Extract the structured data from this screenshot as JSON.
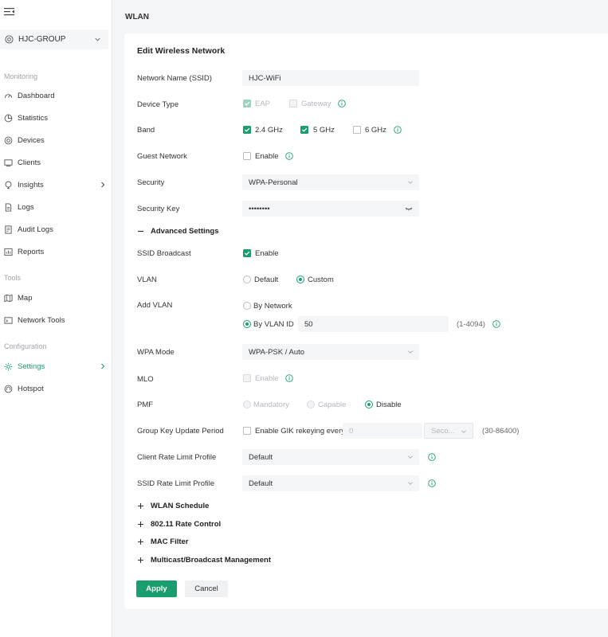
{
  "sidebar": {
    "site": "HJC-GROUP",
    "sections": [
      {
        "label": "Monitoring",
        "items": [
          {
            "label": "Dashboard",
            "icon": "dashboard-icon"
          },
          {
            "label": "Statistics",
            "icon": "pie-chart-icon"
          },
          {
            "label": "Devices",
            "icon": "devices-icon"
          },
          {
            "label": "Clients",
            "icon": "clients-icon"
          },
          {
            "label": "Insights",
            "icon": "bulb-icon"
          },
          {
            "label": "Logs",
            "icon": "logs-icon"
          },
          {
            "label": "Audit Logs",
            "icon": "audit-icon"
          },
          {
            "label": "Reports",
            "icon": "reports-icon"
          }
        ]
      },
      {
        "label": "Tools",
        "items": [
          {
            "label": "Map",
            "icon": "map-icon"
          },
          {
            "label": "Network Tools",
            "icon": "tools-icon"
          }
        ]
      },
      {
        "label": "Configuration",
        "items": [
          {
            "label": "Settings",
            "icon": "gear-icon"
          },
          {
            "label": "Hotspot",
            "icon": "hotspot-icon"
          }
        ]
      }
    ]
  },
  "page": {
    "title": "WLAN"
  },
  "form": {
    "title": "Edit Wireless Network",
    "ssid": {
      "label": "Network Name (SSID)",
      "value": "HJC-WiFi"
    },
    "device_type": {
      "label": "Device Type",
      "eap": "EAP",
      "gateway": "Gateway"
    },
    "band": {
      "label": "Band",
      "b24": "2.4 GHz",
      "b5": "5 GHz",
      "b6": "6 GHz"
    },
    "guest": {
      "label": "Guest Network",
      "option": "Enable"
    },
    "security": {
      "label": "Security",
      "value": "WPA-Personal"
    },
    "security_key": {
      "label": "Security Key",
      "value": "••••••••"
    },
    "advanced": {
      "label": "Advanced Settings"
    },
    "ssid_broadcast": {
      "label": "SSID Broadcast",
      "option": "Enable"
    },
    "vlan": {
      "label": "VLAN",
      "default": "Default",
      "custom": "Custom"
    },
    "add_vlan": {
      "label": "Add VLAN",
      "by_network": "By Network",
      "by_vlan_id": "By VLAN ID",
      "value": "50",
      "range": "(1-4094)"
    },
    "wpa_mode": {
      "label": "WPA Mode",
      "value": "WPA-PSK / Auto"
    },
    "mlo": {
      "label": "MLO",
      "option": "Enable"
    },
    "pmf": {
      "label": "PMF",
      "mandatory": "Mandatory",
      "capable": "Capable",
      "disable": "Disable"
    },
    "gik": {
      "label": "Group Key Update Period",
      "option": "Enable GIK rekeying every",
      "value": "0",
      "unit": "Seco...",
      "range": "(30-86400)"
    },
    "client_rate": {
      "label": "Client Rate Limit Profile",
      "value": "Default"
    },
    "ssid_rate": {
      "label": "SSID Rate Limit Profile",
      "value": "Default"
    },
    "sections": [
      "WLAN Schedule",
      "802.11 Rate Control",
      "MAC Filter",
      "Multicast/Broadcast Management"
    ],
    "apply_label": "Apply",
    "cancel_label": "Cancel"
  },
  "colors": {
    "accent": "#1a9e6e"
  }
}
